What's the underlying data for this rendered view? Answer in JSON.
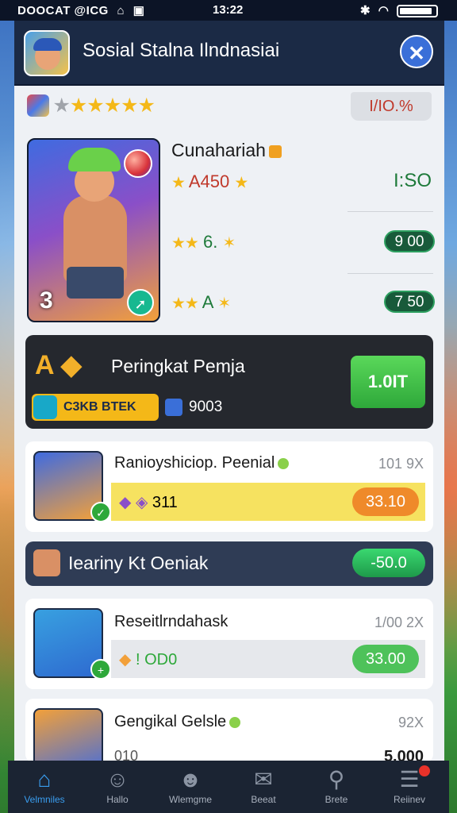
{
  "status_bar": {
    "left_text": "DOOCAT @ICG",
    "time": "13:22",
    "icons": [
      "home-icon",
      "message-icon",
      "bluetooth-icon",
      "wifi-icon",
      "battery-icon"
    ]
  },
  "header": {
    "title": "Sosial Stalna Ilndnasiai",
    "close_icon": "close-icon"
  },
  "top_rating": {
    "stars_filled": 5,
    "stars_total": 6,
    "percent_label": "I/IO.%"
  },
  "hero": {
    "number": "3",
    "title": "Cunahariah",
    "line1_text": "A450",
    "line1_price": "I:SO",
    "line2_text": "6.",
    "line2_price": "9 00",
    "line3_text": "A",
    "line3_price": "7 50"
  },
  "rank_banner": {
    "title": "Peringkat Pemja",
    "chip_label": "C3KB BTEK",
    "count": "9003",
    "cta_label": "1.0IT"
  },
  "items": [
    {
      "name": "Ranioyshiciop. Peenial",
      "mult": "101 9X",
      "bar_text": "311",
      "button_label": "33.10",
      "bar_color": "#f6e260",
      "button_color": "#ef8a2a"
    },
    {
      "name": "Reseitlrndahask",
      "mult": "1/00 2X",
      "bar_text": "! OD0",
      "button_label": "33.00",
      "bar_color": "#e6e8ec",
      "button_color": "#4ec25a"
    },
    {
      "name": "Gengikal Gelsle",
      "mult": "92X",
      "bar_text": "010",
      "button_label": "5.000"
    }
  ],
  "leaderboard_row": {
    "title": "Iearinу Kt Oeniak",
    "button_label": "-50.0"
  },
  "bottom_nav": [
    {
      "label": "Velmniles",
      "icon": "home-icon"
    },
    {
      "label": "Hallo",
      "icon": "people-icon"
    },
    {
      "label": "Wlemgme",
      "icon": "cat-icon"
    },
    {
      "label": "Beeat",
      "icon": "mail-icon"
    },
    {
      "label": "Brete",
      "icon": "search-icon"
    },
    {
      "label": "Reiinev",
      "icon": "menu-icon"
    }
  ],
  "colors": {
    "accent_blue": "#3a9ef0",
    "green_button": "#2ea83a",
    "gold": "#f4b818",
    "dark_panel": "#25282e"
  }
}
